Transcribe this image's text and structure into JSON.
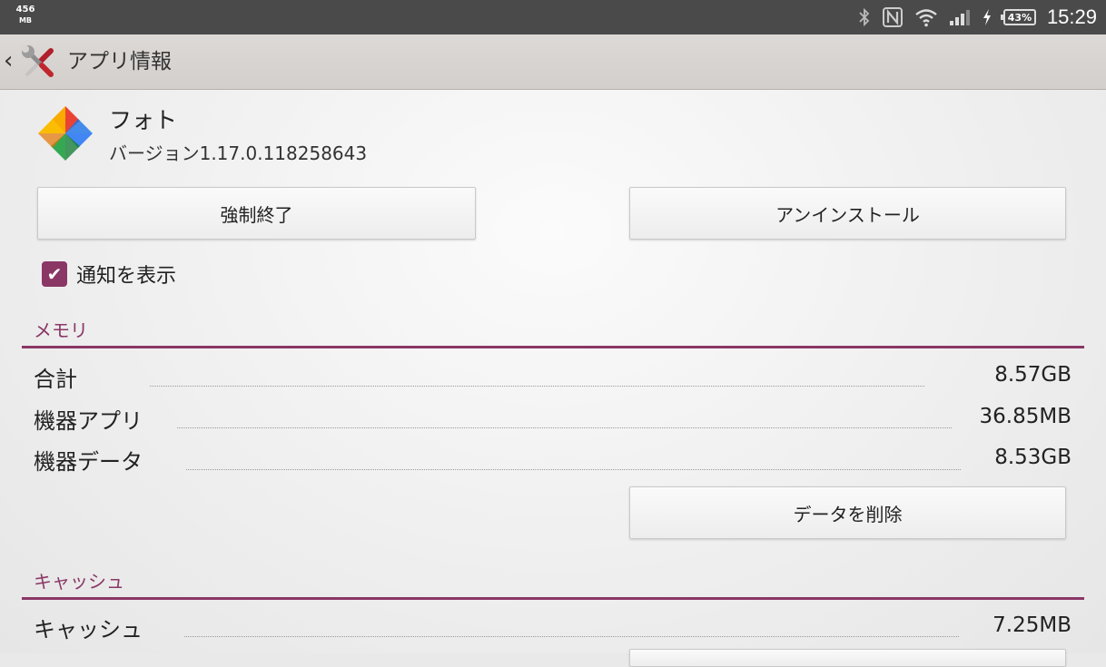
{
  "status_bar": {
    "memory_value": "456",
    "memory_unit": "MB",
    "battery_percent": "43%",
    "time": "15:29",
    "icons": [
      "bluetooth-icon",
      "nfc-icon",
      "wifi-icon",
      "signal-icon",
      "charging-icon",
      "battery-icon"
    ]
  },
  "action_bar": {
    "back_symbol": "‹",
    "title": "アプリ情報",
    "icon": "settings-tools-icon"
  },
  "app": {
    "name": "フォト",
    "version": "バージョン1.17.0.118258643",
    "icon": "photos-pinwheel-icon"
  },
  "buttons": {
    "force_stop": "強制終了",
    "uninstall": "アンインストール",
    "clear_data": "データを削除"
  },
  "notifications": {
    "label": "通知を表示",
    "checked": true,
    "checkmark": "✔"
  },
  "memory": {
    "title": "メモリ",
    "rows": [
      {
        "label": "合計",
        "value": "8.57GB"
      },
      {
        "label": "機器アプリ",
        "value": "36.85MB"
      },
      {
        "label": "機器データ",
        "value": "8.53GB"
      }
    ]
  },
  "cache": {
    "title": "キャッシュ",
    "rows": [
      {
        "label": "キャッシュ",
        "value": "7.25MB"
      }
    ]
  },
  "colors": {
    "accent": "#8a3766",
    "status_bar": "#4a4a4a",
    "action_bar": "#d8d4d1"
  }
}
